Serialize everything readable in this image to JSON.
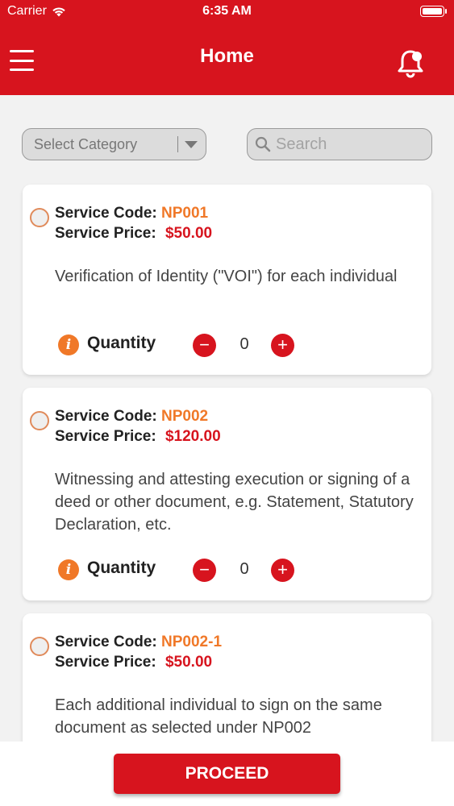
{
  "status_bar": {
    "carrier": "Carrier",
    "time": "6:35 AM"
  },
  "header": {
    "title": "Home",
    "menu_icon": "hamburger-menu-icon",
    "notification_icon": "bell-notification-icon"
  },
  "filters": {
    "category_selected": "Select Category",
    "search_placeholder": "Search",
    "search_value": ""
  },
  "services": [
    {
      "code_label": "Service Code:",
      "code": "NP001",
      "price_label": "Service Price:",
      "price": "$50.00",
      "description": "Verification of Identity (\"VOI\") for each individual",
      "quantity_label": "Quantity",
      "quantity": "0"
    },
    {
      "code_label": "Service Code:",
      "code": "NP002",
      "price_label": "Service Price:",
      "price": "$120.00",
      "description": "Witnessing and attesting execution or signing of a deed or other document, e.g. Statement, Statutory Declaration, etc.",
      "quantity_label": "Quantity",
      "quantity": "0"
    },
    {
      "code_label": "Service Code:",
      "code": "NP002-1",
      "price_label": "Service Price:",
      "price": "$50.00",
      "description": "Each additional individual to sign on the same document as selected under NP002"
    }
  ],
  "footer": {
    "proceed_label": "PROCEED"
  },
  "colors": {
    "brand_red": "#d7141e",
    "code_orange": "#f07828",
    "background": "#f2f2f2"
  }
}
